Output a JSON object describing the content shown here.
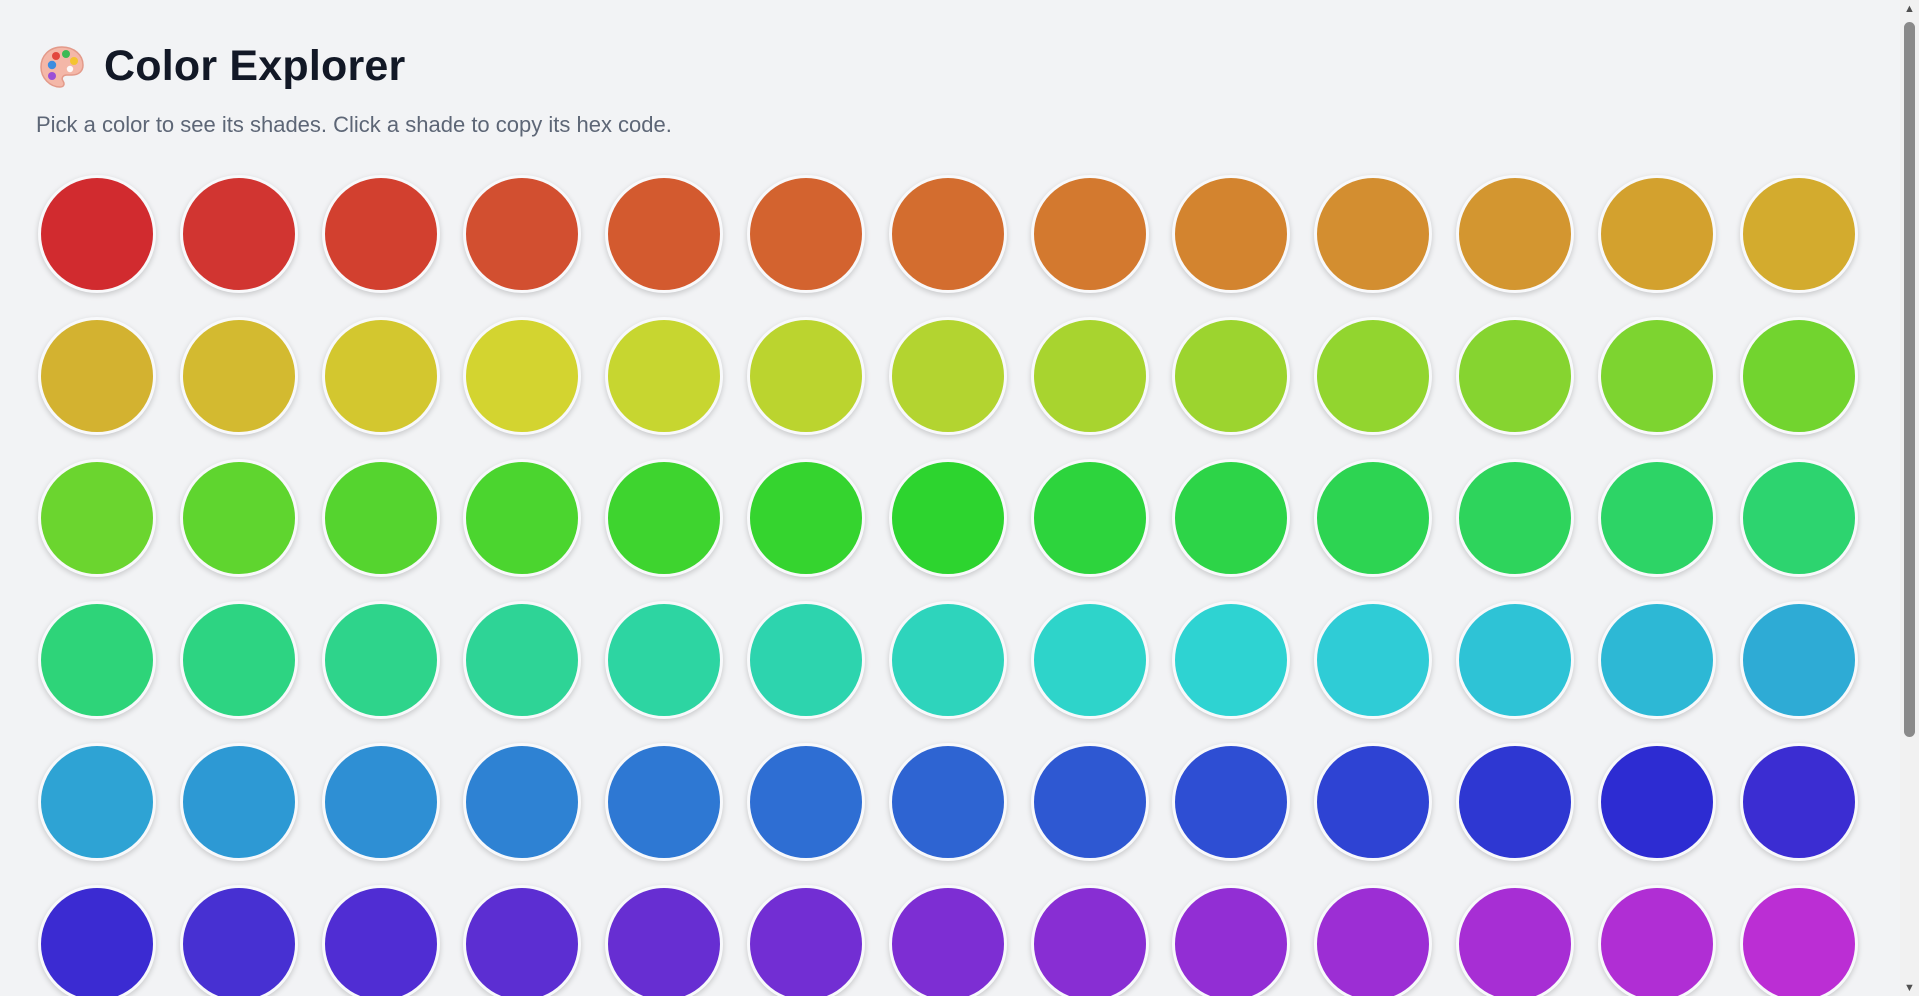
{
  "header": {
    "icon": "palette-icon",
    "title": "Color Explorer",
    "subtitle": "Pick a color to see its shades. Click a shade to copy its hex code."
  },
  "swatches": [
    "#d12b2f",
    "#d13531",
    "#d2402f",
    "#d24f30",
    "#d35a2f",
    "#d3632f",
    "#d36d2f",
    "#d3792f",
    "#d3842f",
    "#d38e30",
    "#d39630",
    "#d3a12e",
    "#d3ab2e",
    "#d3b230",
    "#d3ba30",
    "#d3c72f",
    "#d3d430",
    "#c7d630",
    "#bbd42f",
    "#b3d430",
    "#a8d42f",
    "#9cd42f",
    "#92d52f",
    "#86d430",
    "#7dd430",
    "#72d42f",
    "#6bd52f",
    "#5fd52f",
    "#55d42f",
    "#4bd52f",
    "#3ed42f",
    "#35d42f",
    "#2dd42f",
    "#2dd43d",
    "#2dd448",
    "#2dd452",
    "#2ed45c",
    "#2dd466",
    "#2dd46f",
    "#2ed479",
    "#2dd482",
    "#2ed48b",
    "#2ed496",
    "#2dd5a2",
    "#2dd4ae",
    "#2ed4bc",
    "#2ed4ca",
    "#2ed3d2",
    "#2fccd6",
    "#2ec3d6",
    "#2db8d5",
    "#2eabd5",
    "#2ea3d4",
    "#2d99d4",
    "#2e8fd4",
    "#2e82d3",
    "#2e78d3",
    "#2e6ed3",
    "#2e64d2",
    "#2e58d2",
    "#2e4ed3",
    "#2e43d3",
    "#2e37d2",
    "#2d2cd2",
    "#3b2dd2",
    "#3b2bd2",
    "#4730d2",
    "#502dd3",
    "#5c2ed2",
    "#672ed2",
    "#722ed3",
    "#7d2ed3",
    "#882ed3",
    "#922ed4",
    "#9c2ed4",
    "#a72ed4",
    "#b02ed4",
    "#bb2ed4"
  ],
  "scrollbar": {
    "up_icon": "▲",
    "down_icon": "▼"
  }
}
